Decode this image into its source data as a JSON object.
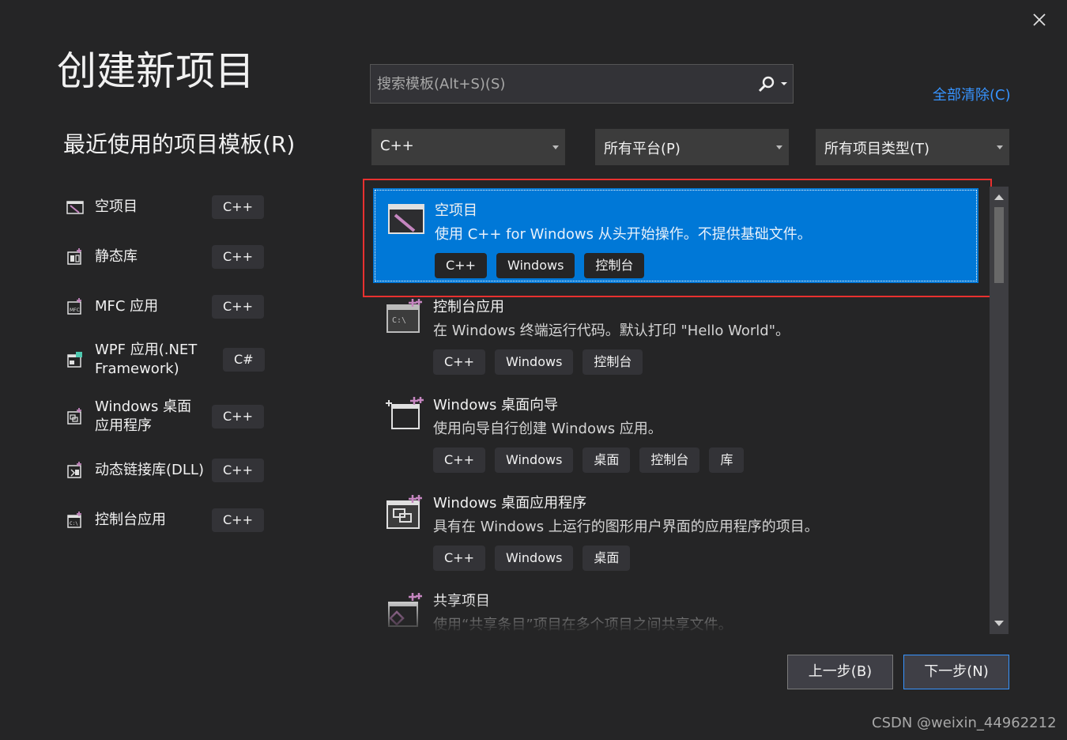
{
  "dialog": {
    "title": "创建新项目",
    "close_icon": "close-icon"
  },
  "recent": {
    "title": "最近使用的项目模板",
    "title_accel": "(R)",
    "items": [
      {
        "label": "空项目",
        "tag": "C++",
        "icon": "empty-project-icon"
      },
      {
        "label": "静态库",
        "tag": "C++",
        "icon": "static-library-icon"
      },
      {
        "label": "MFC 应用",
        "tag": "C++",
        "icon": "mfc-app-icon"
      },
      {
        "label": "WPF 应用(.NET Framework)",
        "tag": "C#",
        "icon": "wpf-app-icon"
      },
      {
        "label": "Windows 桌面应用程序",
        "tag": "C++",
        "icon": "windows-desktop-app-icon"
      },
      {
        "label": "动态链接库(DLL)",
        "tag": "C++",
        "icon": "dll-icon"
      },
      {
        "label": "控制台应用",
        "tag": "C++",
        "icon": "console-app-icon"
      }
    ]
  },
  "search": {
    "placeholder": "搜索模板(Alt+S)(S)",
    "value": ""
  },
  "clear_all": "全部清除(C)",
  "filters": {
    "language": "C++",
    "platform": "所有平台(P)",
    "project_type": "所有项目类型(T)"
  },
  "templates": [
    {
      "name": "空项目",
      "desc": "使用 C++ for Windows 从头开始操作。不提供基础文件。",
      "tags": [
        "C++",
        "Windows",
        "控制台"
      ],
      "icon": "empty-project-icon",
      "selected": true
    },
    {
      "name": "控制台应用",
      "desc": "在 Windows 终端运行代码。默认打印 \"Hello World\"。",
      "tags": [
        "C++",
        "Windows",
        "控制台"
      ],
      "icon": "console-app-icon"
    },
    {
      "name": "Windows 桌面向导",
      "desc": "使用向导自行创建 Windows 应用。",
      "tags": [
        "C++",
        "Windows",
        "桌面",
        "控制台",
        "库"
      ],
      "icon": "desktop-wizard-icon"
    },
    {
      "name": "Windows 桌面应用程序",
      "desc": "具有在 Windows 上运行的图形用户界面的应用程序的项目。",
      "tags": [
        "C++",
        "Windows",
        "桌面"
      ],
      "icon": "windows-desktop-app-icon"
    },
    {
      "name": "共享项目",
      "desc": "使用“共享条目”项目在多个项目之间共享文件。",
      "tags": [],
      "icon": "shared-project-icon"
    }
  ],
  "buttons": {
    "back": "上一步(B)",
    "next": "下一步(N)"
  },
  "watermark": "CSDN @weixin_44962212",
  "colors": {
    "background": "#252526",
    "selection": "#0078d7",
    "accent_link": "#3794ff",
    "highlight_border": "#e8312f"
  }
}
